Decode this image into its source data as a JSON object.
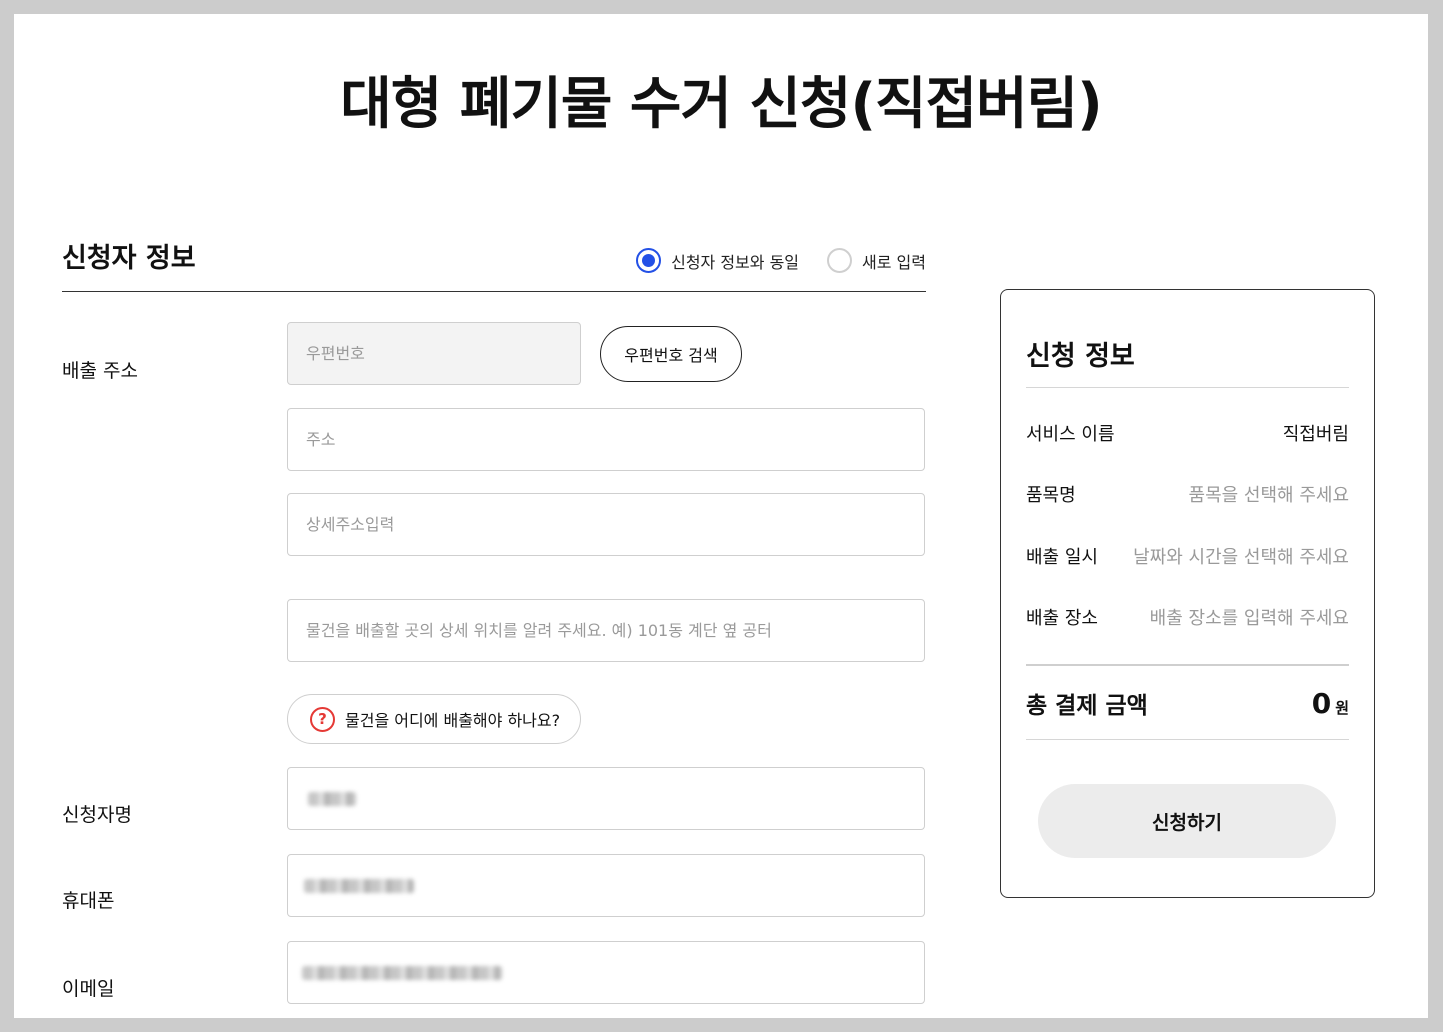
{
  "page": {
    "title": "대형 폐기물 수거 신청(직접버림)"
  },
  "applicant": {
    "section_title": "신청자 정보",
    "radio_options": [
      {
        "label": "신청자 정보와 동일",
        "selected": true
      },
      {
        "label": "새로 입력",
        "selected": false
      }
    ],
    "address_label": "배출 주소",
    "zipcode_placeholder": "우편번호",
    "zipcode_search_label": "우편번호 검색",
    "address_placeholder": "주소",
    "detail_address_placeholder": "상세주소입력",
    "location_placeholder": "물건을 배출할 곳의 상세 위치를 알려 주세요. 예) 101동 계단 옆 공터",
    "help_label": "물건을 어디에 배출해야 하나요?",
    "name_label": "신청자명",
    "phone_label": "휴대폰",
    "email_label": "이메일"
  },
  "summary": {
    "title": "신청 정보",
    "rows": [
      {
        "key": "서비스 이름",
        "value": "직접버림",
        "placeholder": false
      },
      {
        "key": "품목명",
        "value": "품목을 선택해 주세요",
        "placeholder": true
      },
      {
        "key": "배출 일시",
        "value": "날짜와 시간을 선택해 주세요",
        "placeholder": true
      },
      {
        "key": "배출 장소",
        "value": "배출 장소를 입력해 주세요",
        "placeholder": true
      }
    ],
    "total_label": "총 결제 금액",
    "total_amount": "0",
    "total_unit": "원",
    "apply_label": "신청하기"
  },
  "colors": {
    "accent": "#2350e6",
    "help": "#e53935"
  },
  "icons": {
    "help": "question-circle-icon"
  }
}
